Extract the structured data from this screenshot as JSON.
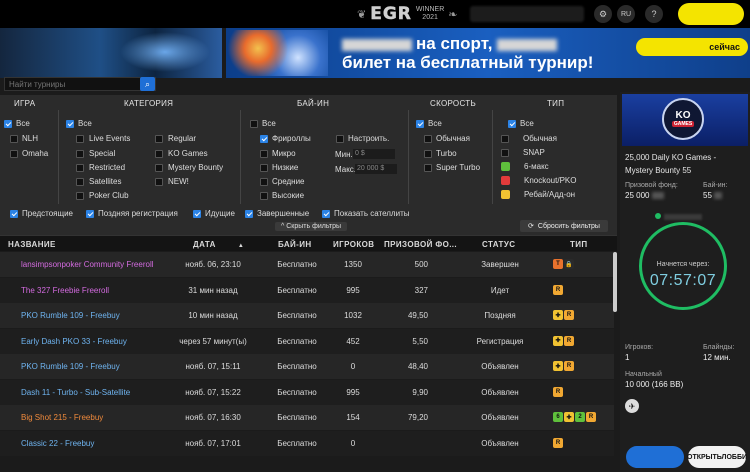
{
  "header": {
    "logo_text": "EGR",
    "logo_winner": "WINNER",
    "logo_year": "2021",
    "lang": "RU",
    "help": "?"
  },
  "banner": {
    "line1": "на спорт,",
    "line2": "билет на бесплатный турнир!",
    "cta_suffix": "сейчас"
  },
  "search": {
    "placeholder": "Найти турниры"
  },
  "filters": {
    "headers": {
      "game": "ИГРА",
      "category": "КАТЕГОРИЯ",
      "buyin": "БАЙ-ИН",
      "speed": "СКОРОСТЬ",
      "type": "ТИП"
    },
    "game": [
      {
        "label": "Все",
        "checked": true
      },
      {
        "label": "NLH",
        "checked": false
      },
      {
        "label": "Omaha",
        "checked": false
      }
    ],
    "category_all": {
      "label": "Все",
      "checked": true
    },
    "category_col1": [
      "Live Events",
      "Special",
      "Restricted",
      "Satellites",
      "Poker Club"
    ],
    "category_col2": [
      "Regular",
      "KO Games",
      "Mystery Bounty",
      "NEW!"
    ],
    "buyin": [
      {
        "label": "Все",
        "checked": false
      },
      {
        "label": "Фрироллы",
        "checked": true
      },
      {
        "label": "Микро",
        "checked": false
      },
      {
        "label": "Низкие",
        "checked": false
      },
      {
        "label": "Средние",
        "checked": false
      },
      {
        "label": "Высокие",
        "checked": false
      }
    ],
    "buyin_custom": {
      "label": "Настроить.",
      "min_label": "Мин.",
      "min_value": "0 $",
      "max_label": "Макс.",
      "max_value": "20 000 $"
    },
    "speed": [
      {
        "label": "Все",
        "checked": true
      },
      {
        "label": "Обычная",
        "checked": false
      },
      {
        "label": "Turbo",
        "checked": false
      },
      {
        "label": "Super Turbo",
        "checked": false
      }
    ],
    "type": [
      {
        "label": "Все",
        "checked": true,
        "icon": "none"
      },
      {
        "label": "Обычная",
        "checked": false,
        "icon": "none"
      },
      {
        "label": "SNAP",
        "checked": false,
        "icon": "none"
      },
      {
        "label": "6-макс",
        "checked": false,
        "icon": "six-max-icon"
      },
      {
        "label": "Knockout/PKO",
        "checked": false,
        "icon": "knockout-icon"
      },
      {
        "label": "Ребай/Адд-он",
        "checked": false,
        "icon": "rebuy-icon"
      }
    ],
    "status_toggles": [
      {
        "label": "Предстоящие",
        "checked": true
      },
      {
        "label": "Поздняя регистрация",
        "checked": true
      },
      {
        "label": "Идущие",
        "checked": true
      },
      {
        "label": "Завершенные",
        "checked": true
      },
      {
        "label": "Показать сателлиты",
        "checked": true
      }
    ],
    "hide_label": "^ Скрыть фильтры",
    "reset_label": "Сбросить фильтры"
  },
  "table": {
    "columns": [
      "НАЗВАНИЕ",
      "ДАТА",
      "БАЙ-ИН",
      "ИГРОКОВ",
      "ПРИЗОВОЙ ФО...",
      "СТАТУС",
      "ТИП"
    ],
    "rows": [
      {
        "name": "lansimpsonpoker Community Freeroll",
        "color": "#d46be0",
        "date": "нояб. 06, 23:10",
        "buyin": "Бесплатно",
        "players": "1350",
        "prize": "500",
        "status": "Завершен",
        "icons": [
          "turbo",
          "lock"
        ]
      },
      {
        "name": "The  327 Freebie Freeroll",
        "color": "#d46be0",
        "date": "31 мин назад",
        "buyin": "Бесплатно",
        "players": "995",
        "prize": "327",
        "status": "Идет",
        "icons": [
          "rebuy"
        ]
      },
      {
        "name": "PKO Rumble 109 - Freebuy",
        "color": "#6fb4f0",
        "date": "10 мин назад",
        "buyin": "Бесплатно",
        "players": "1032",
        "prize": "49,50",
        "status": "Поздняя",
        "icons": [
          "ko",
          "rebuy"
        ]
      },
      {
        "name": "Early Dash PKO 33 - Freebuy",
        "color": "#6fb4f0",
        "date": "через 57 минут(ы)",
        "buyin": "Бесплатно",
        "players": "452",
        "prize": "5,50",
        "status": "Регистрация",
        "icons": [
          "ko",
          "rebuy"
        ]
      },
      {
        "name": "PKO Rumble 109 - Freebuy",
        "color": "#6fb4f0",
        "date": "нояб. 07, 15:11",
        "buyin": "Бесплатно",
        "players": "0",
        "prize": "48,40",
        "status": "Объявлен",
        "icons": [
          "ko",
          "rebuy"
        ]
      },
      {
        "name": "Dash 11 - Turbo - Sub-Satellite",
        "color": "#6fb4f0",
        "date": "нояб. 07, 15:22",
        "buyin": "Бесплатно",
        "players": "995",
        "prize": "9,90",
        "status": "Объявлен",
        "icons": [
          "rebuy"
        ]
      },
      {
        "name": "Big Shot 215 - Freebuy",
        "color": "#f08a3c",
        "date": "нояб. 07, 16:30",
        "buyin": "Бесплатно",
        "players": "154",
        "prize": "79,20",
        "status": "Объявлен",
        "icons": [
          "green",
          "ko",
          "two",
          "rebuy"
        ]
      },
      {
        "name": "Classic 22 - Freebuy",
        "color": "#6fb4f0",
        "date": "нояб. 07, 17:01",
        "buyin": "Бесплатно",
        "players": "0",
        "prize": "",
        "status": "Объявлен",
        "icons": [
          "rebuy"
        ]
      }
    ]
  },
  "side": {
    "logo_top": "KO",
    "logo_bottom": "GAMES",
    "title": "25,000 Daily KO Games - Mystery Bounty 55",
    "prize_label": "Призовой фонд:",
    "prize_value": "25 000",
    "buyin_label": "Бай-ин:",
    "buyin_value": "55",
    "countdown_label": "Начнется через:",
    "countdown": "07:57:07",
    "players_label": "Игроков:",
    "players_value": "1",
    "blinds_label": "Блайнды:",
    "blinds_value": "12 мин.",
    "stack_label": "Начальный",
    "stack_value": "10 000 (166 BB)",
    "lobby_label": "ОТКРЫТЬЛОББИ"
  }
}
